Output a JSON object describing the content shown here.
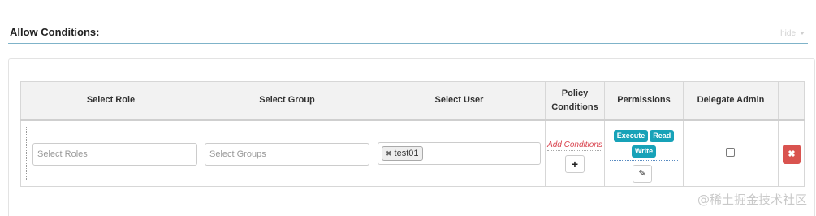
{
  "section": {
    "title": "Allow Conditions:",
    "hide_label": "hide"
  },
  "table": {
    "headers": {
      "role": "Select Role",
      "group": "Select Group",
      "user": "Select User",
      "policy_conditions": "Policy\nConditions",
      "permissions": "Permissions",
      "delegate_admin": "Delegate Admin"
    },
    "rows": [
      {
        "roles_placeholder": "Select Roles",
        "groups_placeholder": "Select Groups",
        "user_tag": "test01",
        "add_conditions_label": "Add Conditions",
        "add_button": "+",
        "permissions": [
          "Execute",
          "Read",
          "Write"
        ],
        "edit_icon": "✎",
        "delegate_admin_checked": false,
        "delete_icon": "✖"
      }
    ]
  },
  "colors": {
    "permission_tag": "#17a2b8",
    "delete_button": "#d9534f",
    "add_conditions": "#d9434e"
  },
  "watermark": "@稀土掘金技术社区"
}
